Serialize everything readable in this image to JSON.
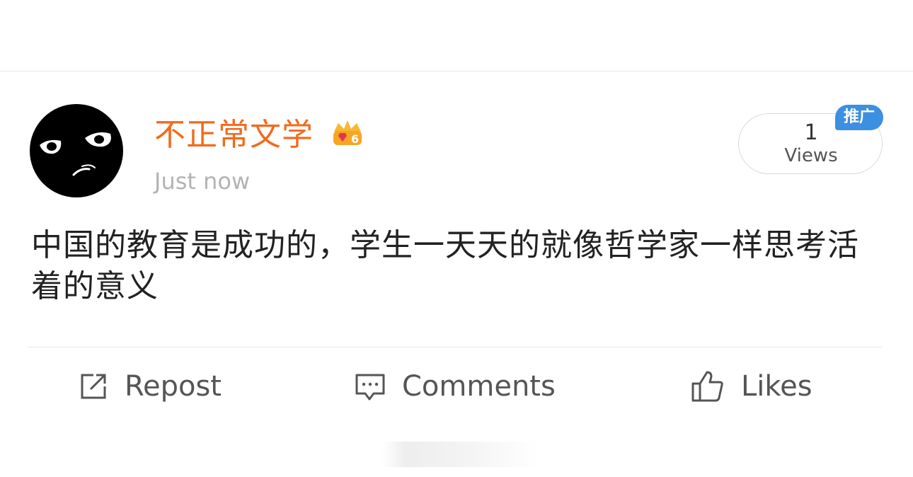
{
  "post": {
    "username": "不正常文学",
    "timestamp": "Just now",
    "views_count": "1",
    "views_label": "Views",
    "promo_badge": "推广",
    "text": "中国的教育是成功的，学生一天天的就像哲学家一样思考活着的意义"
  },
  "actions": {
    "repost_label": "Repost",
    "comments_label": "Comments",
    "likes_label": "Likes"
  },
  "icons": {
    "avatar": "grumpy-face-avatar",
    "badge": "crown-badge-icon",
    "repost": "repost-icon",
    "comments": "comment-icon",
    "likes": "thumbs-up-icon"
  },
  "colors": {
    "username": "#f26a1b",
    "promo_badge": "#3d8fe0",
    "timestamp": "#b3b3b3"
  }
}
